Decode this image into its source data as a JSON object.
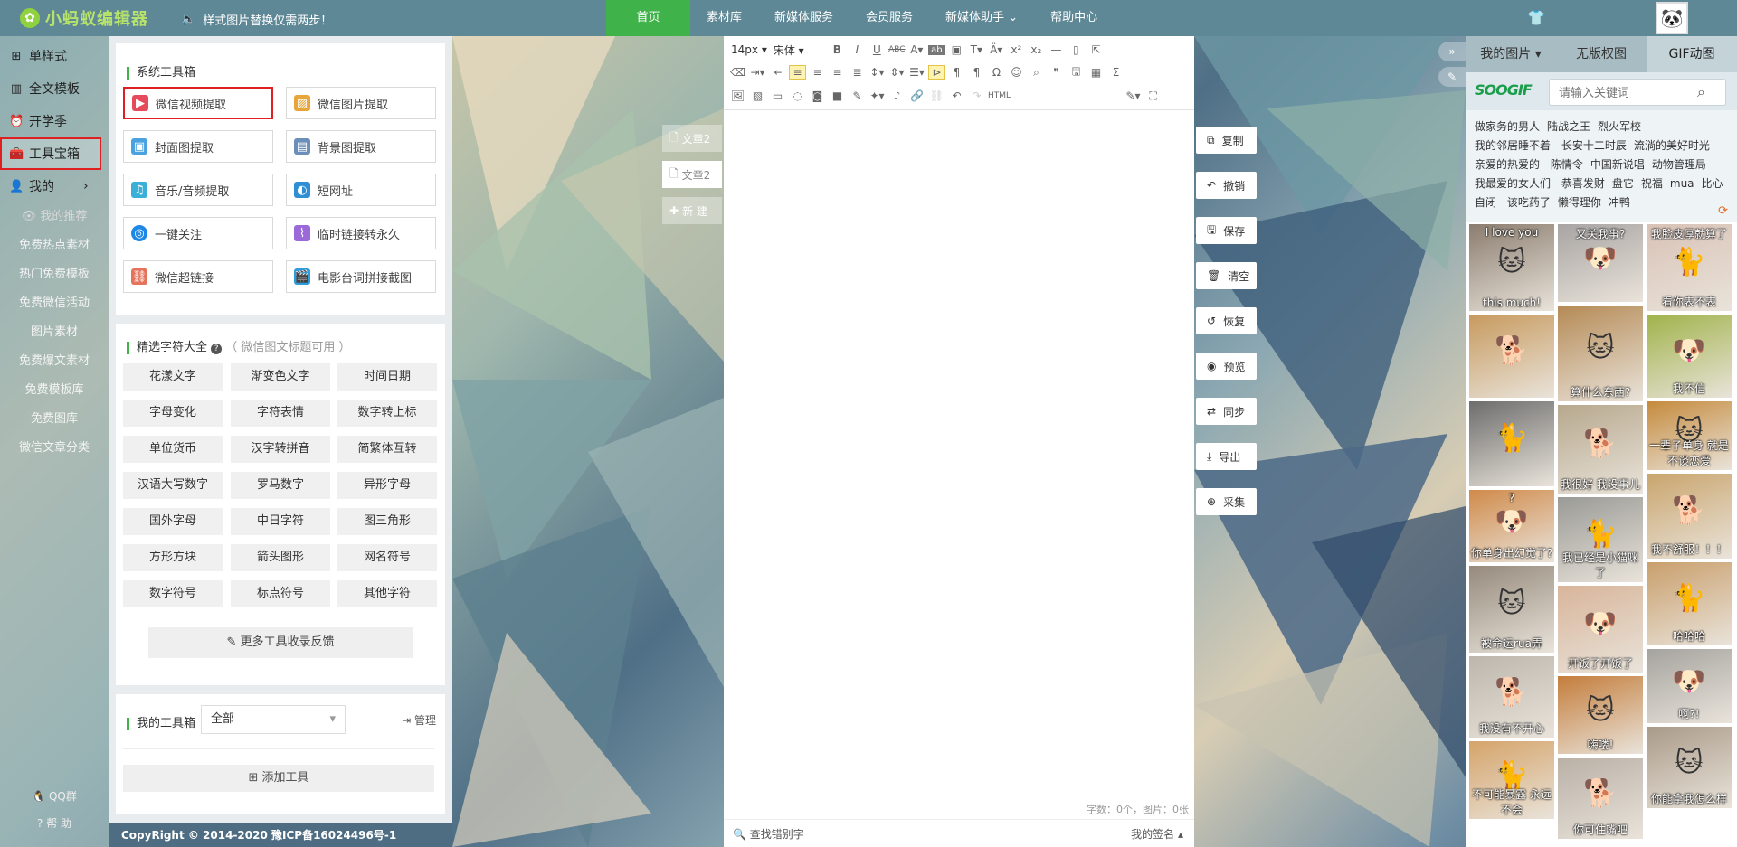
{
  "header": {
    "logo_text": "小蚂蚁编辑器",
    "notice": "样式图片替换仅需两步！",
    "nav": [
      "首页",
      "素材库",
      "新媒体服务",
      "会员服务",
      "新媒体助手",
      "帮助中心"
    ],
    "accent_color": "#3fb24a"
  },
  "sidebar": {
    "items": [
      {
        "label": "单样式",
        "icon": "grid-icon"
      },
      {
        "label": "全文模板",
        "icon": "template-icon"
      },
      {
        "label": "开学季",
        "icon": "clock-icon"
      },
      {
        "label": "工具宝箱",
        "icon": "toolbox-icon"
      },
      {
        "label": "我的",
        "icon": "user-icon"
      }
    ],
    "sub_items": [
      "我的推荐",
      "免费热点素材",
      "热门免费模板",
      "免费微信活动",
      "图片素材",
      "免费爆文素材",
      "免费模板库",
      "免费图库",
      "微信文章分类"
    ],
    "qq": "QQ群",
    "help": "帮 助"
  },
  "tools": {
    "system_title": "系统工具箱",
    "system_buttons": [
      "微信视频提取",
      "微信图片提取",
      "封面图提取",
      "背景图提取",
      "音乐/音频提取",
      "短网址",
      "一键关注",
      "临时链接转永久",
      "微信超链接",
      "电影台词拼接截图"
    ],
    "chars_title": "精选字符大全",
    "chars_note": "（ 微信图文标题可用 ）",
    "chars": [
      "花漾文字",
      "渐变色文字",
      "时间日期",
      "字母变化",
      "字符表情",
      "数字转上标",
      "单位货币",
      "汉字转拼音",
      "简繁体互转",
      "汉语大写数字",
      "罗马数字",
      "异形字母",
      "国外字母",
      "中日字符",
      "图三角形",
      "方形方块",
      "箭头图形",
      "网名符号",
      "数字符号",
      "标点符号",
      "其他字符"
    ],
    "more_label": "更多工具收录反馈",
    "my_title": "我的工具箱",
    "my_select": "全部",
    "manage": "管理",
    "add_tool": "添加工具",
    "copyright": "CopyRight © 2014-2020 豫ICP备16024496号-1"
  },
  "doc_tabs": [
    "文章2",
    "文章2",
    "新 建"
  ],
  "editor": {
    "font_size": "14px",
    "font_family": "宋体",
    "html_label": "HTML",
    "word_count": "字数：0个，图片：0张",
    "find_label": "查找错别字",
    "signature": "我的签名"
  },
  "actions": [
    "复制",
    "撤销",
    "保存",
    "清空",
    "恢复",
    "预览",
    "同步",
    "导出",
    "采集"
  ],
  "right_panel": {
    "tabs": [
      "我的图片",
      "无版权图",
      "GIF动图"
    ],
    "brand": "SOOGIF",
    "search_placeholder": "请输入关键词",
    "tags": [
      "做家务的男人",
      "陆战之王",
      "烈火军校",
      "我的邻居睡不着",
      "长安十二时辰",
      "流淌的美好时光",
      "亲爱的热爱的",
      "陈情令",
      "中国新说唱",
      "动物管理局",
      "我最爱的女人们",
      "恭喜发财",
      "盘它",
      "祝福",
      "mua",
      "比心",
      "自闭",
      "该吃药了",
      "懒得理你",
      "冲鸭"
    ],
    "gifs": [
      {
        "caption": "this much!",
        "top_caption": "I love you",
        "color": "#8b7d6f"
      },
      {
        "caption": "",
        "top_caption": "又关我事?",
        "color": "#a8a4a2"
      },
      {
        "caption": "看你表不表",
        "top_caption": "我脸皮厚就算了",
        "color": "#d9c2b6"
      },
      {
        "caption": "",
        "top_caption": "",
        "color": "#c79a5e"
      },
      {
        "caption": "算什么东西?",
        "top_caption": "",
        "color": "#b58a55"
      },
      {
        "caption": "我不信",
        "top_caption": "",
        "color": "#a0b34a"
      },
      {
        "caption": "",
        "top_caption": "",
        "color": "#6d6d6d"
      },
      {
        "caption": "我很好 我没事儿",
        "top_caption": "",
        "color": "#b7a88d"
      },
      {
        "caption": "一辈子单身 就是不谈恋爱",
        "top_caption": "",
        "color": "#c58a3c"
      },
      {
        "caption": "你单身出幻觉了?",
        "top_caption": "?",
        "color": "#d08a4a"
      },
      {
        "caption": "我已经是小猫咪了",
        "top_caption": "",
        "color": "#9a9a96"
      },
      {
        "caption": "我不舒服！！！",
        "top_caption": "",
        "color": "#c9a56d"
      },
      {
        "caption": "被命运rua弄",
        "top_caption": "",
        "color": "#958a7c"
      },
      {
        "caption": "开饭了开饭了",
        "top_caption": "",
        "color": "#d8b59a"
      },
      {
        "caption": "哈哈哈",
        "top_caption": "",
        "color": "#c99f6c"
      },
      {
        "caption": "我没有不开心",
        "top_caption": "",
        "color": "#bdb6ad"
      },
      {
        "caption": "嗨喽!",
        "top_caption": "",
        "color": "#c47d3b"
      },
      {
        "caption": "啊?!",
        "top_caption": "",
        "color": "#a5a39f"
      },
      {
        "caption": "不可能暴露 永远不会",
        "top_caption": "",
        "color": "#d5a46a"
      },
      {
        "caption": "你可住嘴吧",
        "top_caption": "",
        "color": "#b9b0a6"
      },
      {
        "caption": "你能拿我怎么样",
        "top_caption": "",
        "color": "#a99a88"
      }
    ]
  }
}
